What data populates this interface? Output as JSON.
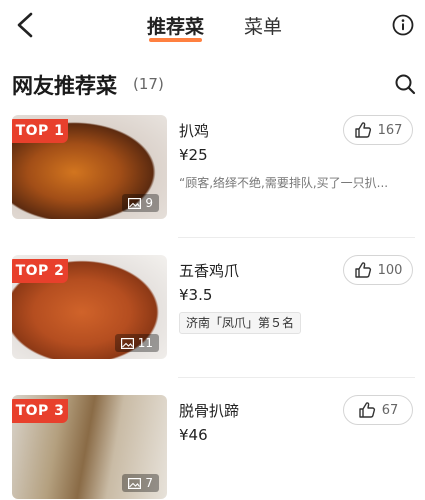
{
  "header": {
    "tabs": [
      {
        "label": "推荐菜",
        "active": true
      },
      {
        "label": "菜单",
        "active": false
      }
    ],
    "back_icon": "chevron-left-icon",
    "info_icon": "info-icon"
  },
  "section": {
    "title": "网友推荐菜",
    "count": "(17)",
    "search_icon": "search-icon"
  },
  "colors": {
    "accent": "#ff6a1f",
    "badge": "#e8402c"
  },
  "dishes": [
    {
      "badge": "TOP 1",
      "name": "扒鸡",
      "price": "¥25",
      "review": "“顾客,络绎不绝,需要排队,买了一只扒...",
      "photos": "9",
      "likes": "167"
    },
    {
      "badge": "TOP 2",
      "name": "五香鸡爪",
      "price": "¥3.5",
      "tag": "济南「凤爪」第５名",
      "photos": "11",
      "likes": "100"
    },
    {
      "badge": "TOP 3",
      "name": "脱骨扒蹄",
      "price": "¥46",
      "photos": "7",
      "likes": "67"
    }
  ]
}
